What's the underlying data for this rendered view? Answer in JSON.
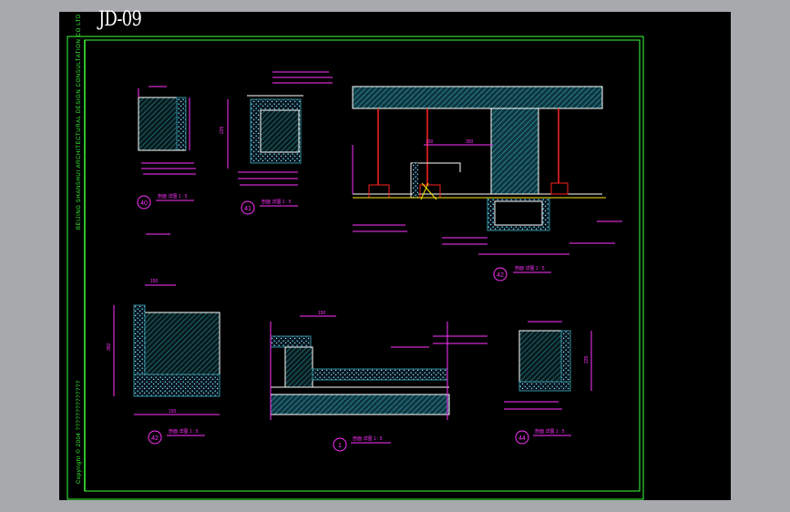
{
  "sheet": {
    "title": "JD-09",
    "company": "BEIJING SHANSHUI ARCHITECTURAL DESIGN CONSULTATION CO LTD",
    "copyright": "Copyright © 2004 ??????????????"
  },
  "details": [
    {
      "marker": "40",
      "scale": "剖面 详图 1 : 5"
    },
    {
      "marker": "41",
      "scale": "剖面 详图 1 : 5"
    },
    {
      "marker": "42",
      "scale": "剖面 详图 1 : 5"
    },
    {
      "marker": "42",
      "scale": "剖面 详图 1 : 5"
    },
    {
      "marker": "1",
      "scale": "剖面 详图 1 : 5"
    },
    {
      "marker": "44",
      "scale": "剖面 详图 1 : 5"
    }
  ],
  "dimensions": {
    "d41_height": "225",
    "d42_top_150": "150",
    "d42_top_350": "350",
    "d42b_top": "150",
    "d42b_side": "350",
    "d42b_bottom": "150",
    "d1_top": "150",
    "d44_side": "225"
  },
  "colors": {
    "background": "#000000",
    "frame": "#3cff3c",
    "dimension": "#ff33ff",
    "structure": "#ffffff",
    "hatch": "#2f8c99",
    "accent_red": "#ff2020",
    "accent_yellow": "#ffe600"
  }
}
